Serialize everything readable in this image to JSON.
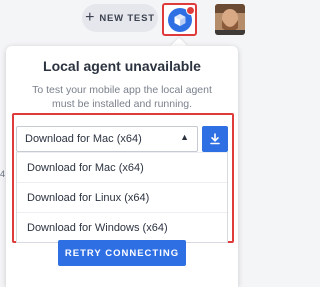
{
  "header": {
    "new_test_label": "NEW TEST",
    "new_test_icon": "plus-icon"
  },
  "agent_status": {
    "icon": "cube-icon",
    "indicator_color": "#e03b3b"
  },
  "side_clip_text": "4",
  "popover": {
    "title": "Local agent unavailable",
    "description": "To test your mobile app the local agent must be installed and running.",
    "select": {
      "selected": "Download for Mac (x64)",
      "options": [
        "Download for Mac (x64)",
        "Download for Linux (x64)",
        "Download for Windows (x64)"
      ]
    },
    "retry_label": "RETRY CONNECTING"
  },
  "colors": {
    "accent": "#2f6fe4",
    "highlight": "#e03b3b",
    "text": "#2c3340",
    "muted": "#7a808c"
  }
}
